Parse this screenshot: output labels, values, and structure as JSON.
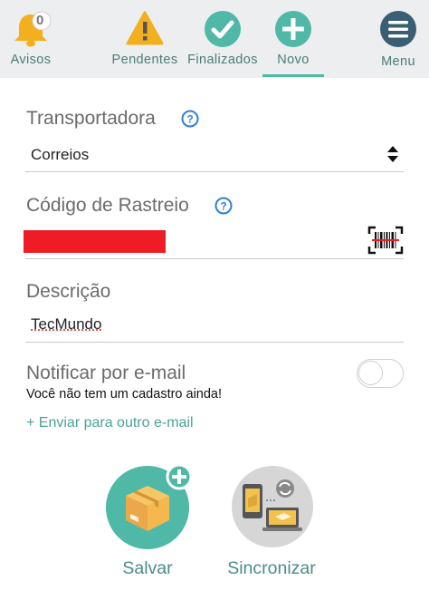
{
  "nav": {
    "items": [
      {
        "label": "Avisos",
        "icon": "bell-icon",
        "badge": "0"
      },
      {
        "label": "Pendentes",
        "icon": "warning-icon"
      },
      {
        "label": "Finalizados",
        "icon": "check-icon"
      },
      {
        "label": "Novo",
        "icon": "plus-icon",
        "active": true
      },
      {
        "label": "Menu",
        "icon": "hamburger-icon"
      }
    ]
  },
  "form": {
    "carrier_label": "Transportadora",
    "carrier_value": "Correios",
    "tracking_label": "Código de Rastreio",
    "description_label": "Descrição",
    "description_value": "TecMundo",
    "notify_label": "Notificar por e-mail",
    "notify_note": "Você não tem um cadastro ainda!",
    "send_other_link": "+ Enviar para outro e-mail"
  },
  "actions": {
    "save_label": "Salvar",
    "sync_label": "Sincronizar"
  },
  "colors": {
    "accent": "#4fb8a6",
    "nav_bg": "#eceeef",
    "warning": "#f2b01e",
    "redaction": "#ee1c24"
  }
}
